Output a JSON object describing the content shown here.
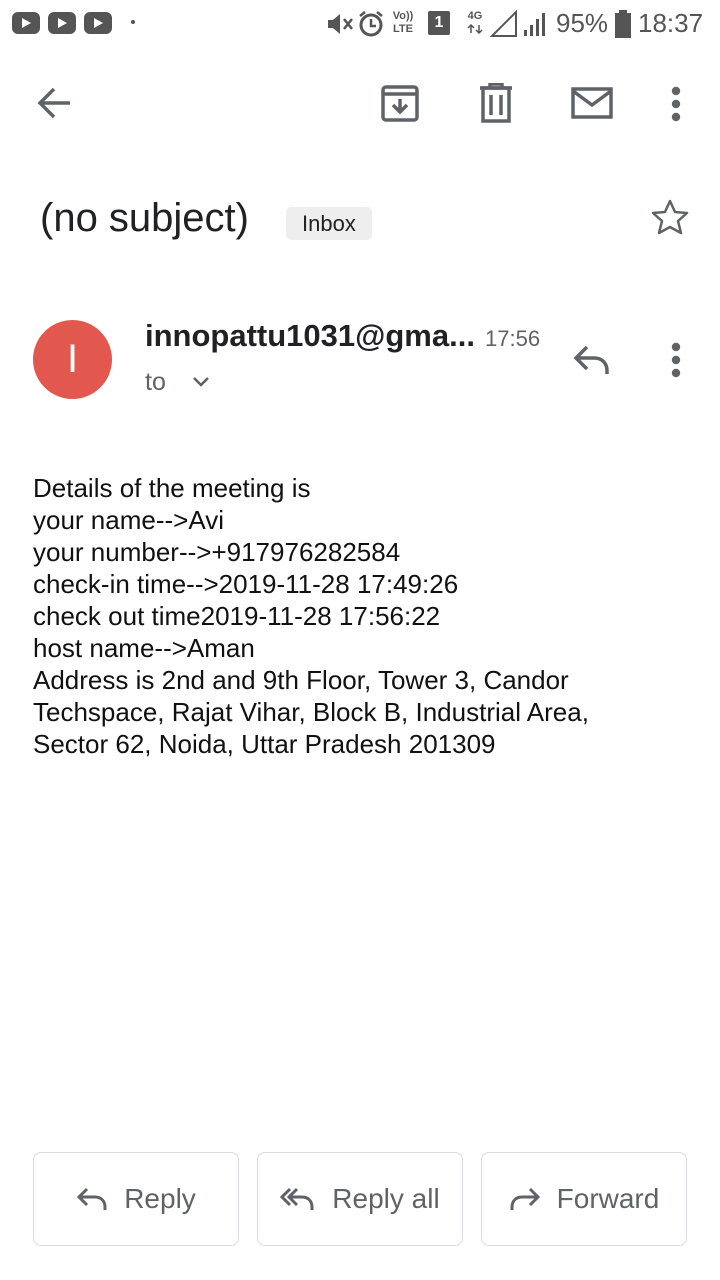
{
  "status_bar": {
    "volte": "Vo))",
    "lte": "LTE",
    "sim_slot": "1",
    "network": "4G",
    "battery": "95%",
    "clock": "18:37"
  },
  "toolbar": {
    "icons": [
      "back-arrow-icon",
      "archive-icon",
      "delete-icon",
      "mark-unread-icon",
      "more-vert-icon"
    ]
  },
  "email": {
    "subject": "(no subject)",
    "label": "Inbox",
    "sender_initial": "I",
    "sender": "innopattu1031@gma...",
    "time": "17:56",
    "recipients_label": "to",
    "avatar_color": "#e2584e",
    "body_lines": [
      "Details of the meeting is",
      "your name-->Avi",
      "your number-->+917976282584",
      "check-in time-->2019-11-28 17:49:26",
      "check out time2019-11-28 17:56:22",
      "host name-->Aman",
      "Address is 2nd and 9th Floor, Tower 3, Candor",
      "Techspace, Rajat Vihar, Block B, Industrial Area,",
      "Sector 62, Noida, Uttar Pradesh 201309"
    ]
  },
  "actions": {
    "reply": "Reply",
    "reply_all": "Reply all",
    "forward": "Forward"
  }
}
